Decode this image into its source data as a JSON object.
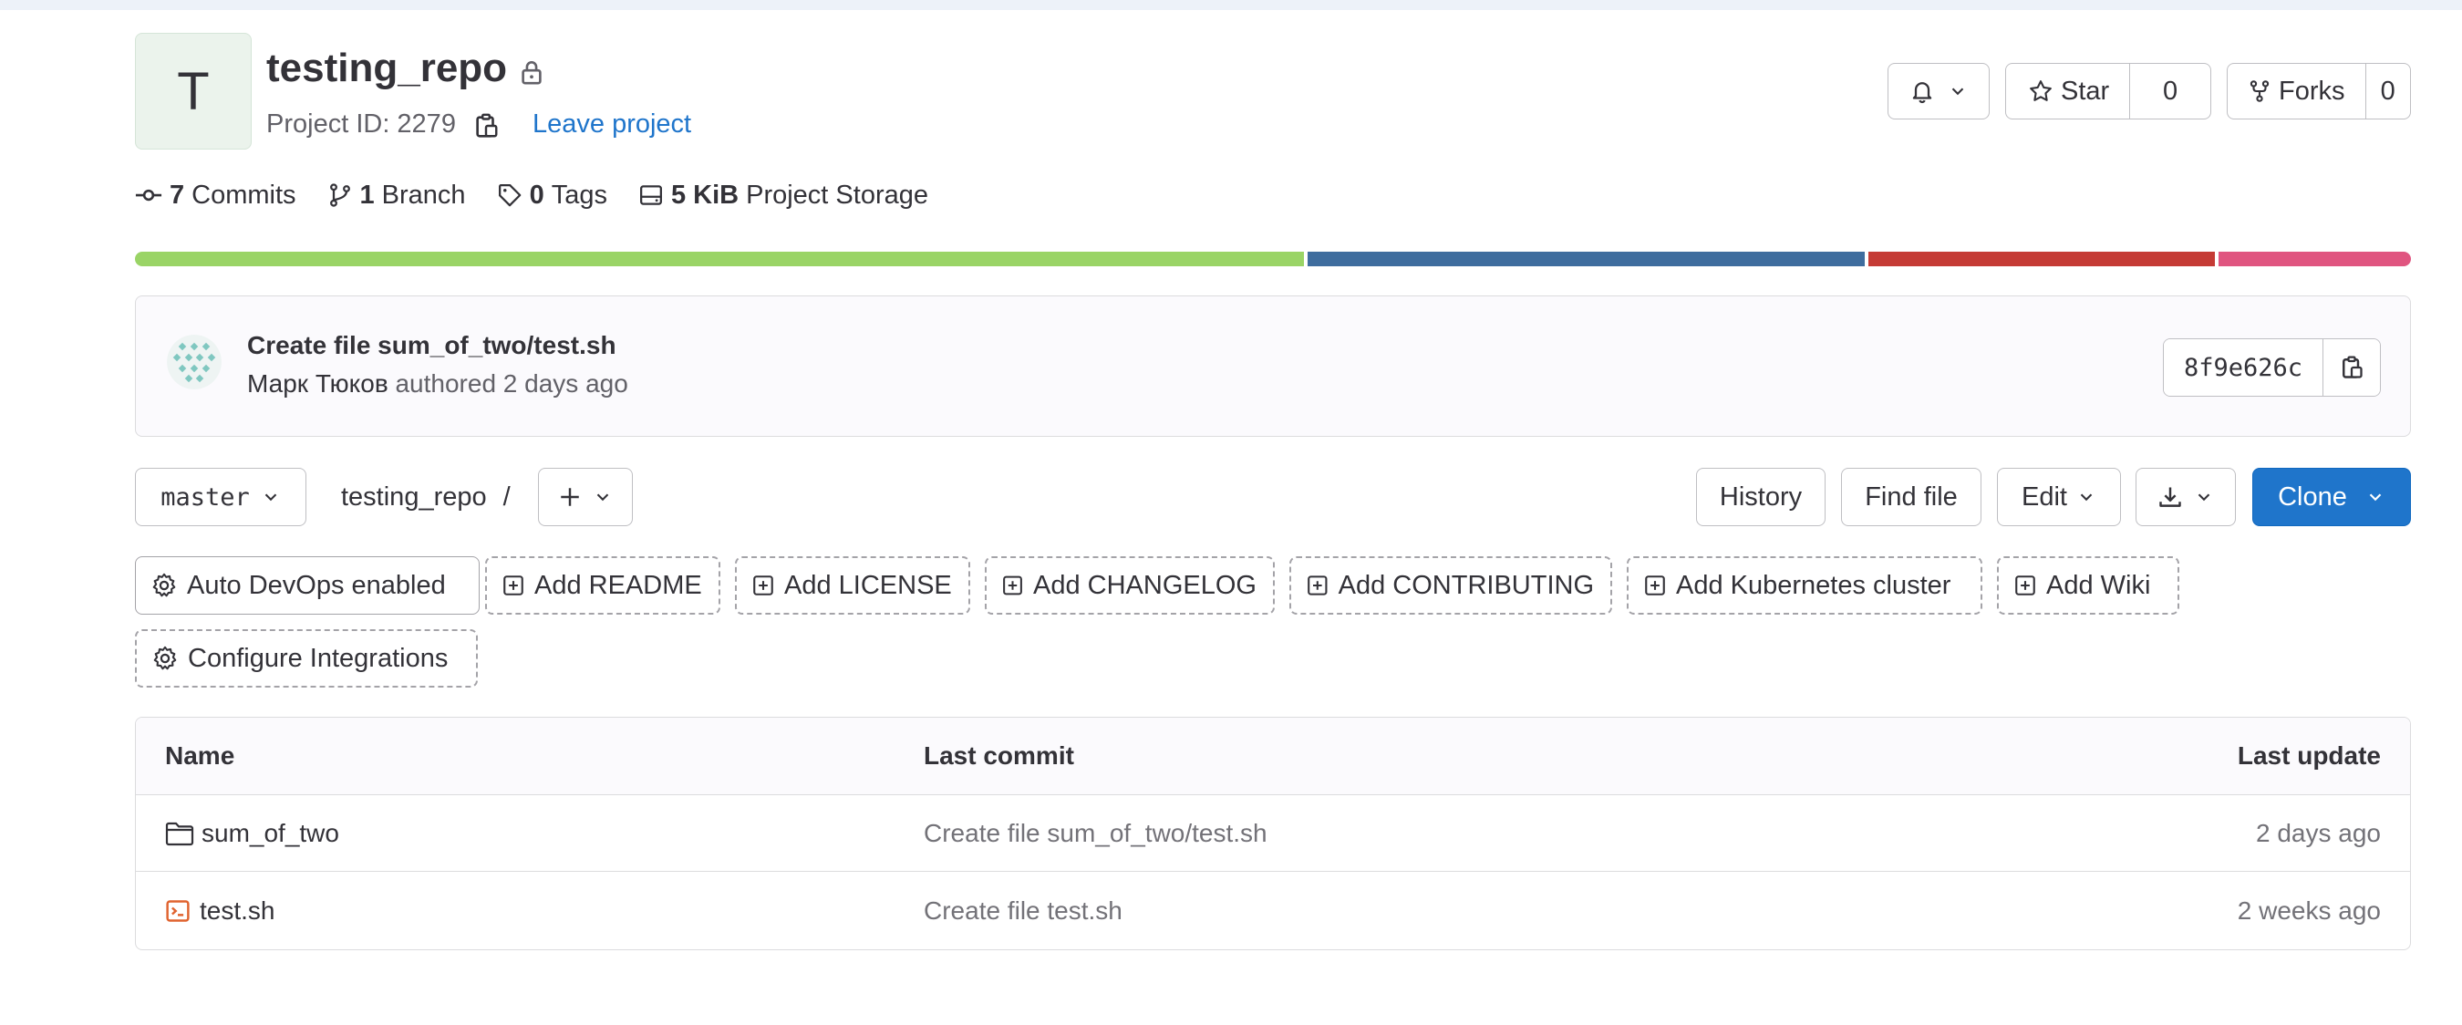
{
  "project": {
    "avatar_letter": "T",
    "name": "testing_repo",
    "id_text": "Project ID: 2279",
    "leave_label": "Leave project"
  },
  "actions": {
    "star_label": "Star",
    "star_count": "0",
    "forks_label": "Forks",
    "forks_count": "0"
  },
  "stats": {
    "commits_count": "7",
    "commits_label": "Commits",
    "branch_count": "1",
    "branch_label": "Branch",
    "tags_count": "0",
    "tags_label": "Tags",
    "storage_size": "5 KiB",
    "storage_label": "Project Storage"
  },
  "language_bar": [
    {
      "color": "#9ad466",
      "share": 0.516
    },
    {
      "color": "#3f6d9e",
      "share": 0.246
    },
    {
      "color": "#c53b35",
      "share": 0.153
    },
    {
      "color": "#e05580",
      "share": 0.085
    }
  ],
  "last_commit": {
    "message": "Create file sum_of_two/test.sh",
    "author": "Марк Тюков",
    "meta": "authored 2 days ago",
    "sha": "8f9e626c"
  },
  "toolbar": {
    "branch": "master",
    "path_repo": "testing_repo",
    "path_sep": "/",
    "history": "History",
    "find_file": "Find file",
    "edit": "Edit",
    "clone": "Clone"
  },
  "quick_actions": {
    "auto_devops": "Auto DevOps enabled",
    "readme": "Add README",
    "license": "Add LICENSE",
    "changelog": "Add CHANGELOG",
    "contributing": "Add CONTRIBUTING",
    "kubernetes": "Add Kubernetes cluster",
    "wiki": "Add Wiki",
    "integrations": "Configure Integrations"
  },
  "file_table": {
    "headers": {
      "name": "Name",
      "last_commit": "Last commit",
      "last_update": "Last update"
    },
    "rows": [
      {
        "type": "folder-icon",
        "name": "sum_of_two",
        "commit": "Create file sum_of_two/test.sh",
        "updated": "2 days ago"
      },
      {
        "type": "terminal-file-icon",
        "name": "test.sh",
        "commit": "Create file test.sh",
        "updated": "2 weeks ago"
      }
    ]
  }
}
